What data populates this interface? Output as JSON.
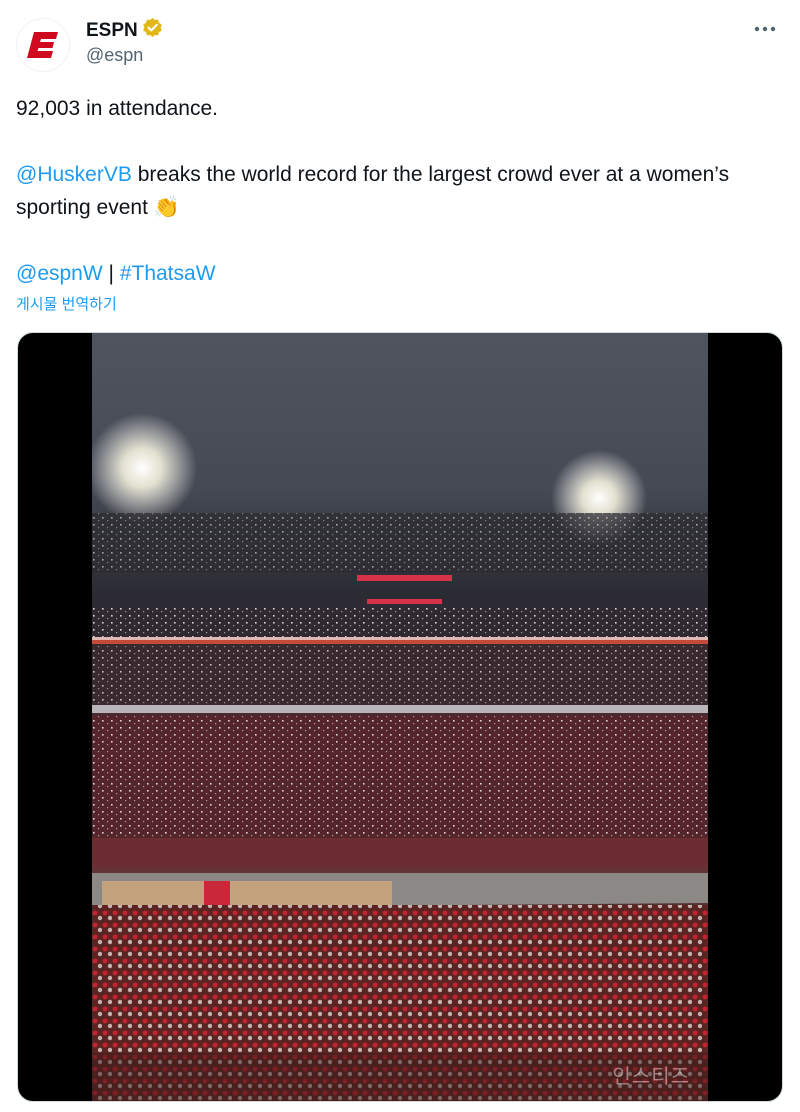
{
  "author": {
    "name": "ESPN",
    "handle": "@espn",
    "avatar_icon": "espn-logo-icon",
    "verified_icon": "verified-badge-icon",
    "verified_color": "#e2b719"
  },
  "tweet": {
    "line1": "92,003 in attendance.",
    "mention1": "@HuskerVB",
    "line2_rest": " breaks the world record for the largest crowd ever at a women’s sporting event 👏",
    "mention2": "@espnW",
    "separator": " | ",
    "hashtag": "#ThatsaW",
    "translate_label": "게시물 번역하기"
  },
  "media": {
    "type": "video",
    "description_icon": "stadium-crowd-video",
    "watermark": "인스티즈"
  },
  "colors": {
    "link": "#1d9bf0",
    "brand_red": "#d00a1e",
    "text": "#0f1419",
    "secondary_text": "#536471"
  }
}
